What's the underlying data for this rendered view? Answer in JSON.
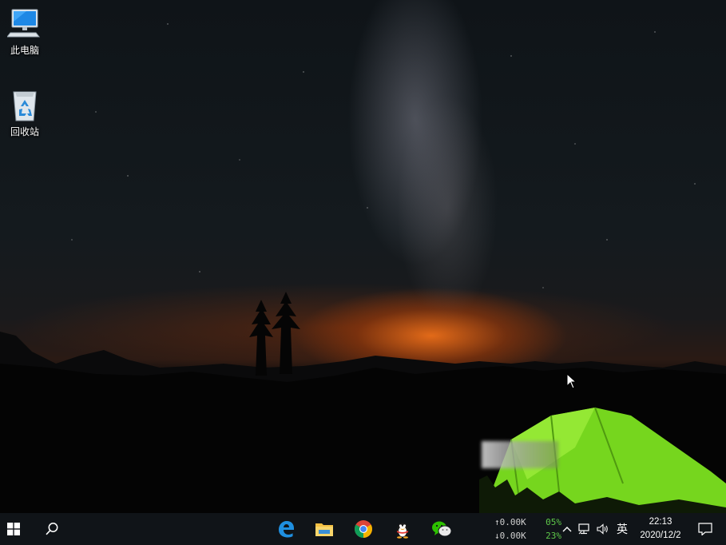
{
  "desktop": {
    "icons": [
      {
        "label": "此电脑",
        "icon": "this-pc-icon"
      },
      {
        "label": "回收站",
        "icon": "recycle-bin-icon"
      }
    ]
  },
  "taskbar": {
    "pinned": [
      {
        "name": "edge",
        "icon": "edge-icon"
      },
      {
        "name": "file-explorer",
        "icon": "folder-icon"
      },
      {
        "name": "chrome",
        "icon": "chrome-icon"
      },
      {
        "name": "qq",
        "icon": "qq-penguin-icon"
      },
      {
        "name": "wechat",
        "icon": "wechat-icon"
      }
    ],
    "net_meter": {
      "upload_rate": "↑0.00K",
      "upload_pct": "05%",
      "download_rate": "↓0.00K",
      "download_pct": "23%"
    },
    "tray": {
      "ime_label": "英"
    },
    "clock": {
      "time": "22:13",
      "date": "2020/12/2"
    }
  },
  "colors": {
    "taskbar_bg": "#101418",
    "accent_green": "#5ec84a",
    "tent_green": "#7ee020",
    "horizon_orange": "#eb6e19"
  }
}
